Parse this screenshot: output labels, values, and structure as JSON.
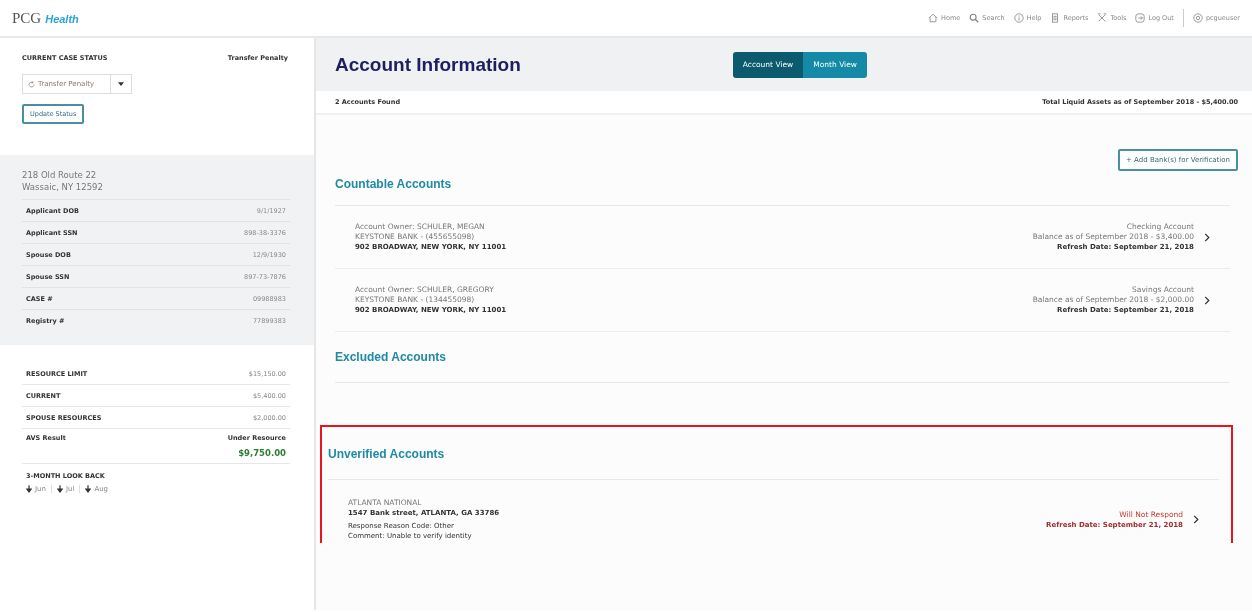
{
  "logo": {
    "brand": "PCG",
    "product": "Health"
  },
  "nav": [
    {
      "label": "Home"
    },
    {
      "label": "Search"
    },
    {
      "label": "Help"
    },
    {
      "label": "Reports"
    },
    {
      "label": "Tools"
    },
    {
      "label": "Log Out"
    }
  ],
  "user": "pcgueuser",
  "sidebar": {
    "status_label": "CURRENT CASE STATUS",
    "status_value": "Transfer Penalty",
    "status_select": "Transfer Penalty",
    "update_button": "Update Status",
    "address": [
      "218 Old Route 22",
      "Wassaic, NY  12592"
    ],
    "details": [
      {
        "label": "Applicant DOB",
        "value": "9/1/1927"
      },
      {
        "label": "Applicant SSN",
        "value": "898-38-3376"
      },
      {
        "label": "Spouse DOB",
        "value": "12/9/1930"
      },
      {
        "label": "Spouse SSN",
        "value": "897-73-7876"
      },
      {
        "label": "CASE #",
        "value": "09988983"
      },
      {
        "label": "Registry #",
        "value": "77899383"
      }
    ],
    "resources": [
      {
        "label": "RESOURCE LIMIT",
        "value": "$15,150.00"
      },
      {
        "label": "CURRENT",
        "value": "$5,400.00"
      },
      {
        "label": "SPOUSE RESOURCES",
        "value": "$2,000.00"
      }
    ],
    "avs": {
      "label": "AVS Result",
      "status": "Under Resource",
      "amount": "$9,750.00"
    },
    "lookback": {
      "title": "3-MONTH LOOK BACK",
      "months": [
        "Jun",
        "Jul",
        "Aug"
      ]
    }
  },
  "main": {
    "title": "Account Information",
    "views": [
      {
        "label": "Account View",
        "selected": true
      },
      {
        "label": "Month View",
        "selected": false
      }
    ],
    "found": "2 Accounts Found",
    "total": "Total Liquid Assets as of September 2018 - $5,400.00",
    "add_button": "+ Add Bank(s) for Verification",
    "sections": [
      {
        "title": "Countable Accounts",
        "highlighted": false,
        "accounts": [
          {
            "kind": "verified",
            "owner": "Account Owner: SCHULER, MEGAN",
            "bank": "KEYSTONE BANK - (455655098)",
            "address": "902 BROADWAY, NEW YORK, NY 11001",
            "type": "Checking Account",
            "balance": "Balance as of September 2018 - $3,400.00",
            "refresh": "Refresh Date: September 21, 2018"
          },
          {
            "kind": "verified",
            "owner": "Account Owner: SCHULER, GREGORY",
            "bank": "KEYSTONE BANK - (134455098)",
            "address": "902 BROADWAY, NEW YORK, NY 11001",
            "type": "Savings Account",
            "balance": "Balance as of September 2018 - $2,000.00",
            "refresh": "Refresh Date: September 21, 2018"
          }
        ]
      },
      {
        "title": "Excluded Accounts",
        "highlighted": false
      },
      {
        "title": "Unverified Accounts",
        "highlighted": true,
        "accounts": [
          {
            "kind": "unverified",
            "bank": "ATLANTA NATIONAL",
            "address": "1547 Bank street, ATLANTA, GA 33786",
            "reason": "Response Reason Code: Other",
            "comment": "Comment: Unable to verify identity",
            "type": "Will Not Respond",
            "refresh": "Refresh Date: September 21, 2018"
          }
        ]
      }
    ]
  }
}
